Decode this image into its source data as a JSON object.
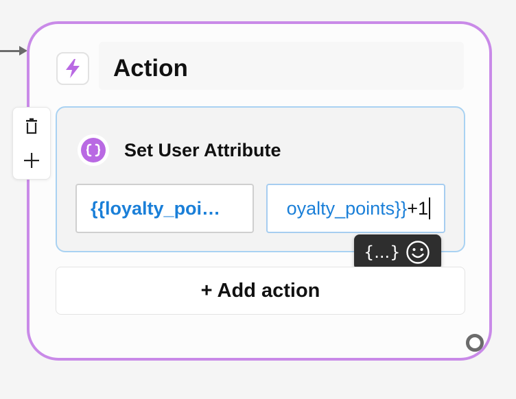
{
  "node": {
    "title": "Action",
    "icon": "lightning-bolt-icon",
    "border_color": "#c98ae8"
  },
  "toolbar": {
    "delete_icon": "trash-icon",
    "add_icon": "plus-icon"
  },
  "step": {
    "title": "Set User Attribute",
    "icon": "braces-icon",
    "icon_color": "#b969e3",
    "attribute_field": {
      "value": "{{loyalty_poi…"
    },
    "value_field": {
      "variable_text": "oyalty_points}}",
      "suffix_text": "+1"
    }
  },
  "insert_popover": {
    "variable_label": "{...}",
    "emoji_icon": "smiley-icon"
  },
  "add_action_label": "+ Add action",
  "colors": {
    "accent_blue": "#1a7fd8",
    "selected_border": "#a9d2f2"
  }
}
